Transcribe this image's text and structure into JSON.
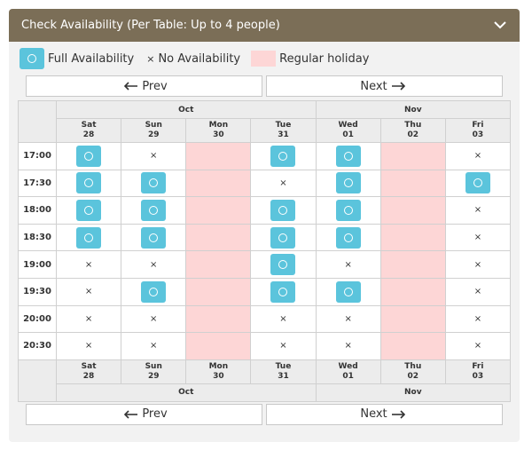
{
  "header": {
    "title": "Check Availability (Per Table: Up to 4 people)",
    "toggle_icon": "chevron-down-icon"
  },
  "legend": {
    "full": "Full Availability",
    "none_symbol": "×",
    "none": "No Availability",
    "holiday": "Regular holiday"
  },
  "nav": {
    "prev": "Prev",
    "next": "Next"
  },
  "months": [
    {
      "label": "Oct",
      "span": 4
    },
    {
      "label": "Nov",
      "span": 3
    }
  ],
  "days": [
    {
      "dow": "Sat",
      "date": "28"
    },
    {
      "dow": "Sun",
      "date": "29"
    },
    {
      "dow": "Mon",
      "date": "30"
    },
    {
      "dow": "Tue",
      "date": "31"
    },
    {
      "dow": "Wed",
      "date": "01"
    },
    {
      "dow": "Thu",
      "date": "02"
    },
    {
      "dow": "Fri",
      "date": "03"
    }
  ],
  "slots": [
    {
      "time": "17:00",
      "status": [
        "full",
        "no",
        "holiday",
        "full",
        "full",
        "holiday",
        "no"
      ]
    },
    {
      "time": "17:30",
      "status": [
        "full",
        "full",
        "holiday",
        "no",
        "full",
        "holiday",
        "full"
      ]
    },
    {
      "time": "18:00",
      "status": [
        "full",
        "full",
        "holiday",
        "full",
        "full",
        "holiday",
        "no"
      ]
    },
    {
      "time": "18:30",
      "status": [
        "full",
        "full",
        "holiday",
        "full",
        "full",
        "holiday",
        "no"
      ]
    },
    {
      "time": "19:00",
      "status": [
        "no",
        "no",
        "holiday",
        "full",
        "no",
        "holiday",
        "no"
      ]
    },
    {
      "time": "19:30",
      "status": [
        "no",
        "full",
        "holiday",
        "full",
        "full",
        "holiday",
        "no"
      ]
    },
    {
      "time": "20:00",
      "status": [
        "no",
        "no",
        "holiday",
        "no",
        "no",
        "holiday",
        "no"
      ]
    },
    {
      "time": "20:30",
      "status": [
        "no",
        "no",
        "holiday",
        "no",
        "no",
        "holiday",
        "no"
      ]
    }
  ],
  "colors": {
    "header_bg": "#7b6e57",
    "full": "#5bc4dc",
    "holiday": "#fdd6d6"
  }
}
